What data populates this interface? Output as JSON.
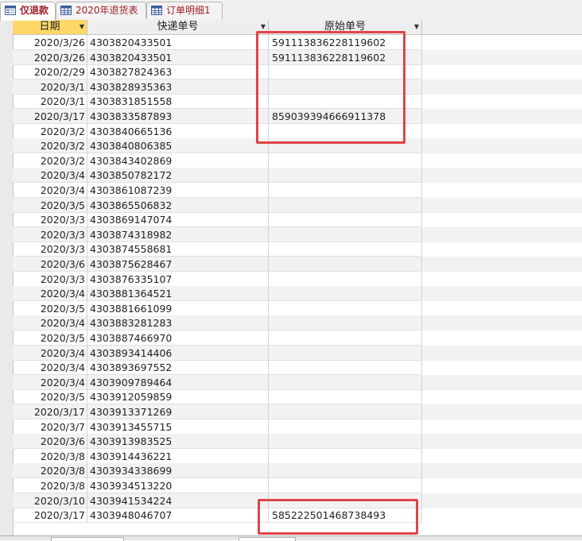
{
  "tabs": [
    {
      "label": "仅退款",
      "icon": "form-icon",
      "active": true
    },
    {
      "label": "2020年退货表",
      "icon": "table-icon",
      "active": false
    },
    {
      "label": "订单明细1",
      "icon": "table-icon",
      "active": false
    }
  ],
  "columns": [
    {
      "label": "日期",
      "selected": true
    },
    {
      "label": "快递单号",
      "selected": false
    },
    {
      "label": "原始单号",
      "selected": false
    }
  ],
  "rows": [
    [
      "2020/3/26",
      "4303820433501",
      "591113836228119602"
    ],
    [
      "2020/3/26",
      "4303820433501",
      "591113836228119602"
    ],
    [
      "2020/2/29",
      "4303827824363",
      ""
    ],
    [
      "2020/3/1",
      "4303828935363",
      ""
    ],
    [
      "2020/3/1",
      "4303831851558",
      ""
    ],
    [
      "2020/3/17",
      "4303833587893",
      "859039394666911378"
    ],
    [
      "2020/3/2",
      "4303840665136",
      ""
    ],
    [
      "2020/3/2",
      "4303840806385",
      ""
    ],
    [
      "2020/3/2",
      "4303843402869",
      ""
    ],
    [
      "2020/3/4",
      "4303850782172",
      ""
    ],
    [
      "2020/3/4",
      "4303861087239",
      ""
    ],
    [
      "2020/3/5",
      "4303865506832",
      ""
    ],
    [
      "2020/3/3",
      "4303869147074",
      ""
    ],
    [
      "2020/3/3",
      "4303874318982",
      ""
    ],
    [
      "2020/3/3",
      "4303874558681",
      ""
    ],
    [
      "2020/3/6",
      "4303875628467",
      ""
    ],
    [
      "2020/3/3",
      "4303876335107",
      ""
    ],
    [
      "2020/3/4",
      "4303881364521",
      ""
    ],
    [
      "2020/3/5",
      "4303881661099",
      ""
    ],
    [
      "2020/3/4",
      "4303883281283",
      ""
    ],
    [
      "2020/3/5",
      "4303887466970",
      ""
    ],
    [
      "2020/3/4",
      "4303893414406",
      ""
    ],
    [
      "2020/3/4",
      "4303893697552",
      ""
    ],
    [
      "2020/3/4",
      "4303909789464",
      ""
    ],
    [
      "2020/3/5",
      "4303912059859",
      ""
    ],
    [
      "2020/3/17",
      "4303913371269",
      ""
    ],
    [
      "2020/3/7",
      "4303913455715",
      ""
    ],
    [
      "2020/3/6",
      "4303913983525",
      ""
    ],
    [
      "2020/3/8",
      "4303914436221",
      ""
    ],
    [
      "2020/3/8",
      "4303934338699",
      ""
    ],
    [
      "2020/3/8",
      "4303934513220",
      ""
    ],
    [
      "2020/3/10",
      "4303941534224",
      ""
    ],
    [
      "2020/3/17",
      "4303948046707",
      "585222501468738493"
    ]
  ],
  "colors": {
    "accent_red": "#e04448",
    "tab_text": "#a11f2a",
    "selected_header": "#fdd866"
  }
}
